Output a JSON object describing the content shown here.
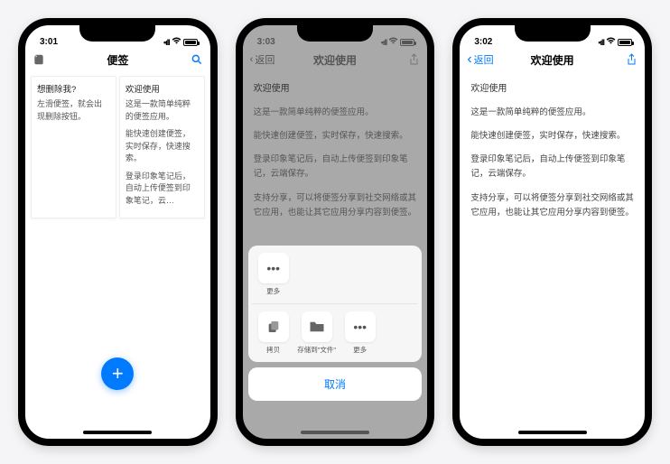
{
  "screen1": {
    "time": "3:01",
    "nav_title": "便签",
    "notes": [
      {
        "title": "想删除我?",
        "body": [
          "左滑便签，就会出现删除按钮。"
        ]
      },
      {
        "title": "欢迎使用",
        "body": [
          "这是一款简单纯粹的便签应用。",
          "能快速创建便签，实时保存，快速搜索。",
          "登录印象笔记后，自动上传便签到印象笔记，云…"
        ]
      }
    ]
  },
  "screen2": {
    "time": "3:03",
    "back": "返回",
    "nav_title": "欢迎使用",
    "detail": {
      "title": "欢迎使用",
      "paras": [
        "这是一款简单纯粹的便签应用。",
        "能快速创建便签，实时保存，快速搜索。",
        "登录印象笔记后，自动上传便签到印象笔记，云端保存。",
        "支持分享，可以将便签分享到社交网络或其它应用，也能让其它应用分享内容到便签。"
      ]
    },
    "share": {
      "row1": [
        {
          "icon": "•••",
          "label": "更多"
        }
      ],
      "row2": [
        {
          "icon": "copy",
          "label": "拷贝"
        },
        {
          "icon": "folder",
          "label": "存储到\"文件\""
        },
        {
          "icon": "•••",
          "label": "更多"
        }
      ],
      "cancel": "取消"
    }
  },
  "screen3": {
    "time": "3:02",
    "back": "返回",
    "nav_title": "欢迎使用",
    "detail": {
      "title": "欢迎使用",
      "paras": [
        "这是一款简单纯粹的便签应用。",
        "能快速创建便签，实时保存，快速搜索。",
        "登录印象笔记后，自动上传便签到印象笔记，云端保存。",
        "支持分享，可以将便签分享到社交网络或其它应用，也能让其它应用分享内容到便签。"
      ]
    }
  }
}
